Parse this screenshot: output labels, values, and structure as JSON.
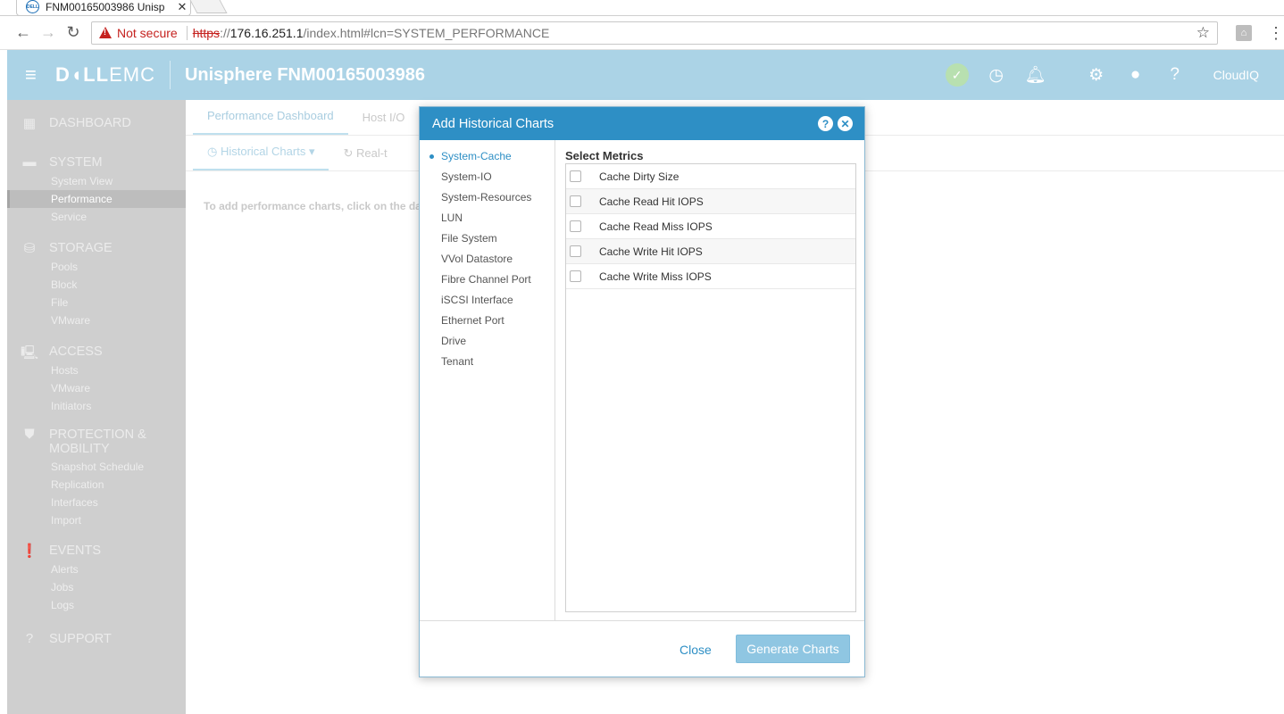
{
  "browser": {
    "tab_title": "FNM00165003986 Unisp",
    "favicon_text": "DELL",
    "not_secure": "Not secure",
    "url_scheme": "https",
    "url_sep": "://",
    "url_host": "176.16.251.1",
    "url_path": "/index.html#lcn=SYSTEM_PERFORMANCE"
  },
  "header": {
    "brand_dell": "D◖LL",
    "brand_emc": "EMC",
    "title": "Unisphere FNM00165003986",
    "cloudiq": "CloudIQ"
  },
  "sidebar": {
    "sections": [
      {
        "label": "DASHBOARD",
        "items": []
      },
      {
        "label": "SYSTEM",
        "items": [
          "System View",
          "Performance",
          "Service"
        ]
      },
      {
        "label": "STORAGE",
        "items": [
          "Pools",
          "Block",
          "File",
          "VMware"
        ]
      },
      {
        "label": "ACCESS",
        "items": [
          "Hosts",
          "VMware",
          "Initiators"
        ]
      },
      {
        "label": "PROTECTION &",
        "label2": "MOBILITY",
        "items": [
          "Snapshot Schedule",
          "Replication",
          "Interfaces",
          "Import"
        ]
      },
      {
        "label": "EVENTS",
        "items": [
          "Alerts",
          "Jobs",
          "Logs"
        ]
      },
      {
        "label": "SUPPORT",
        "items": []
      }
    ]
  },
  "main": {
    "tabs": [
      "Performance Dashboard",
      "Host I/O"
    ],
    "subtabs": [
      "Historical Charts",
      "Real-t"
    ],
    "hint": "To add performance charts, click on the da"
  },
  "modal": {
    "title": "Add Historical Charts",
    "categories": [
      "System-Cache",
      "System-IO",
      "System-Resources",
      "LUN",
      "File System",
      "VVol Datastore",
      "Fibre Channel Port",
      "iSCSI Interface",
      "Ethernet Port",
      "Drive",
      "Tenant"
    ],
    "selected_category": "System-Cache",
    "metrics_title": "Select Metrics",
    "metrics": [
      "Cache Dirty Size",
      "Cache Read Hit IOPS",
      "Cache Read Miss IOPS",
      "Cache Write Hit IOPS",
      "Cache Write Miss IOPS"
    ],
    "close_label": "Close",
    "generate_label": "Generate Charts"
  },
  "colors": {
    "header_bg": "#abd3e6",
    "modal_header": "#2e8fc5",
    "sidebar_bg": "#cfcfcf"
  }
}
